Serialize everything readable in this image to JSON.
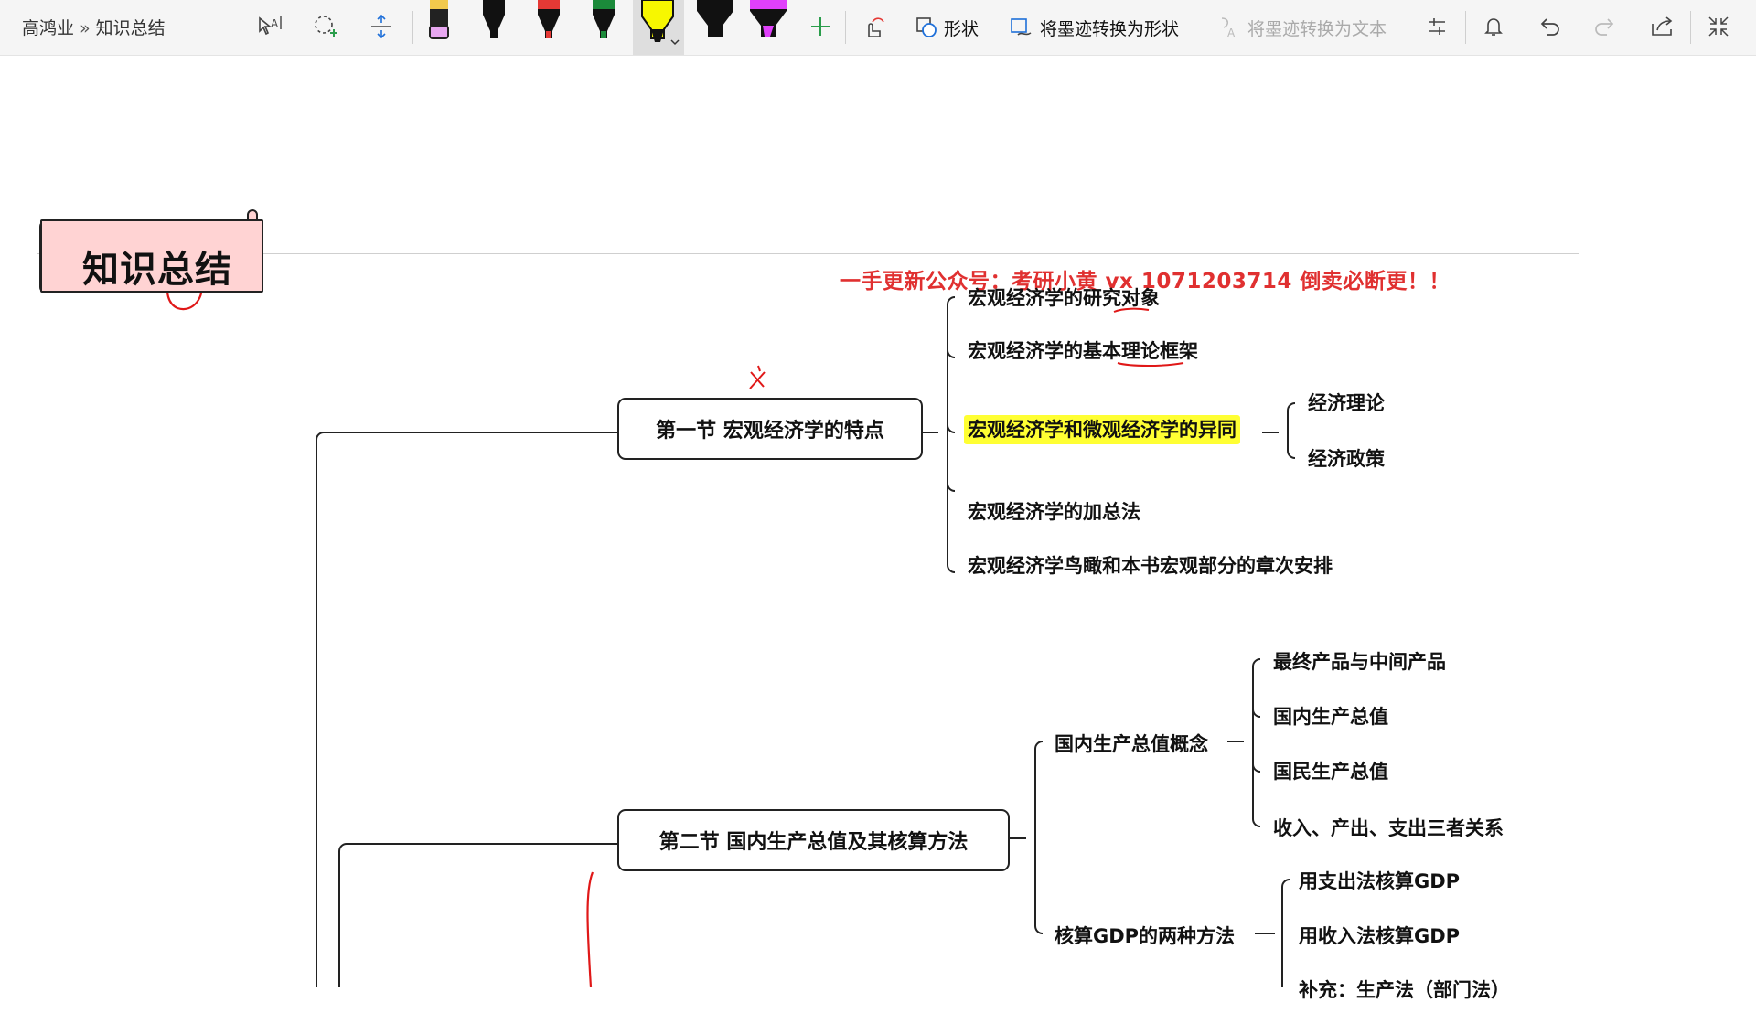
{
  "header": {
    "breadcrumb": {
      "parent": "高鸿业",
      "separator": "»",
      "current": "知识总结"
    }
  },
  "toolbar": {
    "shapes_label": "形状",
    "ink_to_shape_label": "将墨迹转换为形状",
    "ink_to_text_label": "将墨迹转换为文本",
    "pen_colors": [
      "#f4c7f0",
      "#000000",
      "#e53935",
      "#1b8a3a",
      "#ffff00",
      "#000000",
      "#e040fb"
    ]
  },
  "canvas": {
    "title": "知识总结",
    "watermark": "一手更新公众号：考研小黄 vx 1071203714 倒卖必断更！！",
    "section1": {
      "title": "第一节 宏观经济学的特点",
      "items": [
        "宏观经济学的研究对象",
        "宏观经济学的基本理论框架",
        "宏观经济学和微观经济学的异同",
        "宏观经济学的加总法",
        "宏观经济学鸟瞰和本书宏观部分的章次安排"
      ],
      "sub_items": [
        "经济理论",
        "经济政策"
      ]
    },
    "section2": {
      "title": "第二节 国内生产总值及其核算方法",
      "gdp_concept": {
        "title": "国内生产总值概念",
        "items": [
          "最终产品与中间产品",
          "国内生产总值",
          "国民生产总值",
          "收入、产出、支出三者关系"
        ]
      },
      "gdp_methods": {
        "title": "核算GDP的两种方法",
        "items": [
          "用支出法核算GDP",
          "用收入法核算GDP",
          "补充：生产法（部门法）"
        ]
      }
    }
  }
}
